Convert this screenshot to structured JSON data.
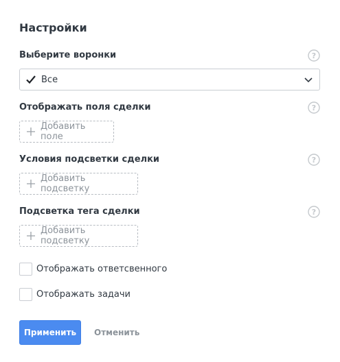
{
  "settings": {
    "title": "Настройки",
    "funnels": {
      "label": "Выберите воронки",
      "selected_value": "Все",
      "help_icon": "question-circle-icon",
      "arrow_icon": "chevron-down-icon"
    },
    "fields": {
      "label": "Отображать поля сделки",
      "add_label": "Добавить поле",
      "help_icon": "question-circle-icon"
    },
    "highlight_conditions": {
      "label": "Условия подсветки сделки",
      "add_label": "Добавить подсветку",
      "help_icon": "question-circle-icon"
    },
    "tag_highlight": {
      "label": "Подсветка тега сделки",
      "add_label": "Добавить подсветку",
      "help_icon": "question-circle-icon"
    },
    "show_responsible": {
      "label": "Отображать ответсвенного",
      "checked": false
    },
    "show_tasks": {
      "label": "Отображать задачи",
      "checked": false
    },
    "apply_label": "Применить",
    "cancel_label": "Отменить"
  },
  "colors": {
    "accent": "#4b8bf0",
    "text": "#313942",
    "muted": "#8c939a",
    "border": "#c9cdd2"
  }
}
